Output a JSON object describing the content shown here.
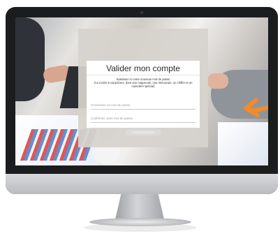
{
  "form": {
    "title": "Valider mon compte",
    "instructions_line1": "Saisissez ici votre nouveau mot de passe",
    "instructions_line2": "(Au moins 8 caractères, dont une majuscule, une minuscule, un chiffre et un caractère spécial)",
    "password_placeholder": "Choisissez un mot de passe",
    "confirm_placeholder": "Confirmez votre mot de passe",
    "submit_label": "CONFIRMATION"
  },
  "colors": {
    "monitor_frame": "#1b1c1e",
    "overlay": "#d6d3ce",
    "card": "#ffffff",
    "button": "#dcdcdc",
    "arrow": "#f28a2e"
  }
}
